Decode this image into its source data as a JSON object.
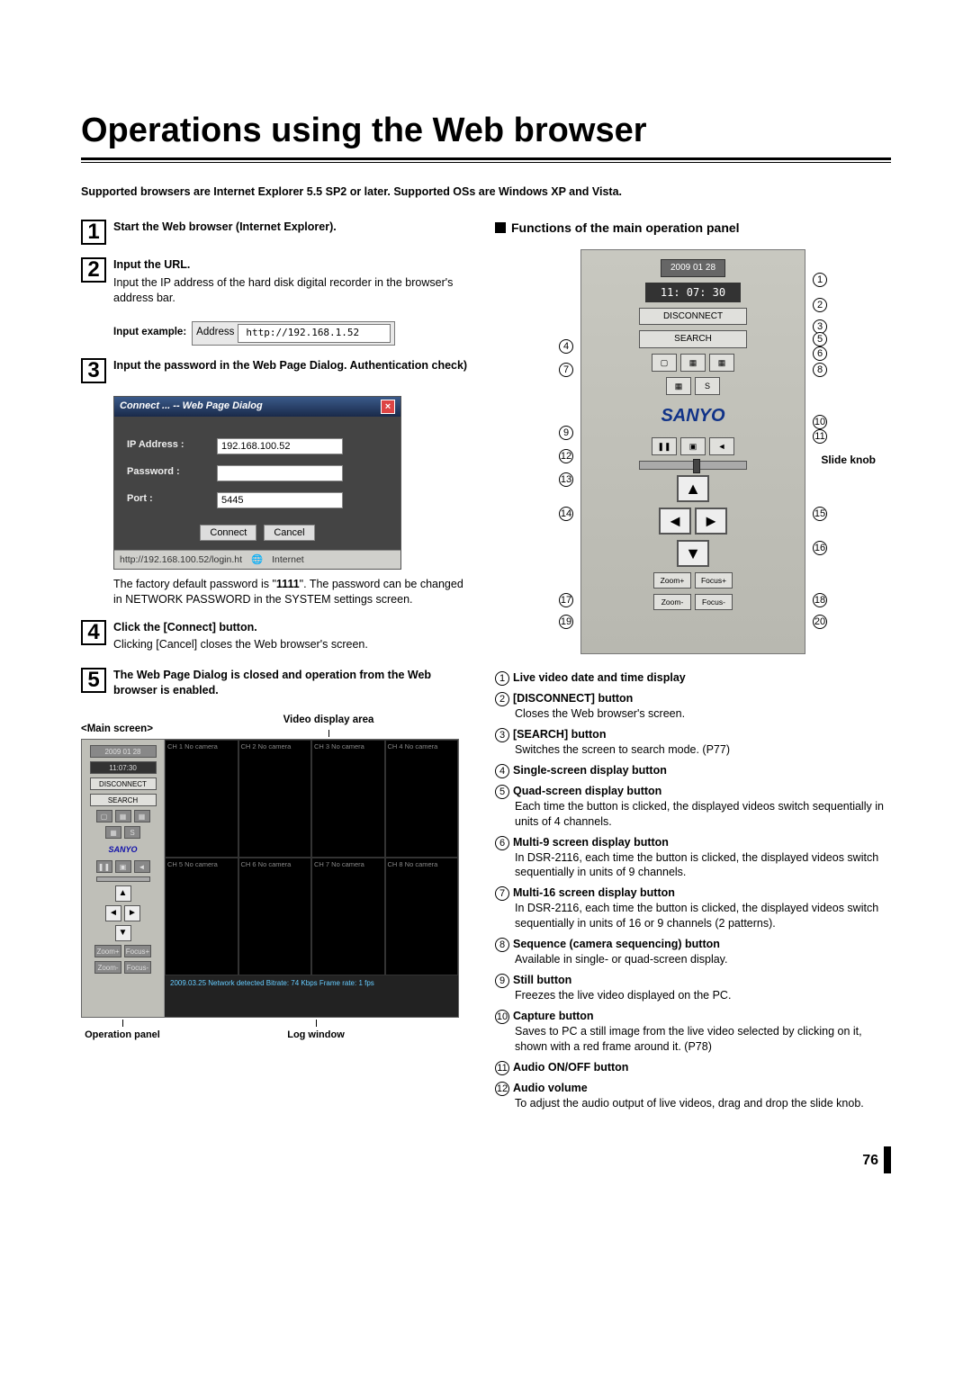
{
  "title": "Operations using the Web browser",
  "intro": "Supported browsers are Internet Explorer 5.5 SP2 or later. Supported OSs are Windows XP and Vista.",
  "steps": {
    "s1": {
      "num": "1",
      "title": "Start the Web browser (Internet Explorer)."
    },
    "s2": {
      "num": "2",
      "title": "Input the URL.",
      "body": "Input the IP address of the hard disk digital recorder in the browser's address bar."
    },
    "input_example": {
      "label": "Input example:",
      "addr_label": "Address",
      "url": "http://192.168.1.52"
    },
    "s3": {
      "num": "3",
      "title": "Input the password in the Web Page Dialog. Authentication check)"
    },
    "dialog": {
      "title": "Connect ... -- Web Page Dialog",
      "ip_label": "IP Address :",
      "ip_value": "192.168.100.52",
      "pw_label": "Password :",
      "pw_value": "",
      "port_label": "Port :",
      "port_value": "5445",
      "connect": "Connect",
      "cancel": "Cancel",
      "status_url": "http://192.168.100.52/login.ht",
      "status_zone": "Internet"
    },
    "s3_note_a": "The factory default password is \"",
    "s3_note_pw": "1111",
    "s3_note_b": "\". The password can be changed in NETWORK PASSWORD in the SYSTEM settings screen.",
    "s4": {
      "num": "4",
      "title": "Click the [Connect] button.",
      "body": "Clicking [Cancel] closes the Web browser's screen."
    },
    "s5": {
      "num": "5",
      "title": "The Web Page Dialog is closed and operation from the Web browser is enabled."
    },
    "mainscreen_label": "<Main screen>",
    "video_area_label": "Video display area",
    "op_panel_label": "Operation panel",
    "log_label": "Log window",
    "ms_panel": {
      "date": "2009 01 28",
      "time": "11:07:30",
      "disconnect": "DISCONNECT",
      "search": "SEARCH",
      "brand": "SANYO",
      "zoom_p": "Zoom+",
      "focus_p": "Focus+",
      "zoom_m": "Zoom-",
      "focus_m": "Focus-"
    },
    "video_cells": {
      "c1": "CH 1\nNo camera",
      "c2": "CH 2\nNo camera",
      "c3": "CH 3\nNo camera",
      "c4": "CH 4\nNo camera",
      "c5": "CH 5\nNo camera",
      "c6": "CH 6\nNo camera",
      "c7": "CH 7\nNo camera",
      "c8": "CH 8\nNo camera"
    },
    "video_log": "2009.03.25 Network detected\nBitrate: 74 Kbps  Frame rate: 1 fps"
  },
  "right": {
    "section_title": "Functions of the main operation panel",
    "panel": {
      "date": "2009  01  28",
      "time": "11: 07: 30",
      "disconnect": "DISCONNECT",
      "search": "SEARCH",
      "s_btn": "S",
      "brand": "SANYO",
      "zoom_p": "Zoom+",
      "focus_p": "Focus+",
      "zoom_m": "Zoom-",
      "focus_m": "Focus-"
    },
    "slide_knob": "Slide knob",
    "functions": [
      {
        "n": "1",
        "t": "Live video date and time display",
        "b": ""
      },
      {
        "n": "2",
        "t": "[DISCONNECT] button",
        "b": "Closes the Web browser's screen."
      },
      {
        "n": "3",
        "t": "[SEARCH] button",
        "b": "Switches the screen to search mode. (P77)"
      },
      {
        "n": "4",
        "t": "Single-screen display button",
        "b": ""
      },
      {
        "n": "5",
        "t": "Quad-screen display button",
        "b": "Each time the button is clicked, the displayed videos switch sequentially in units of 4 channels."
      },
      {
        "n": "6",
        "t": "Multi-9 screen display button",
        "b": "In DSR-2116, each time the button is clicked, the displayed videos switch sequentially in units of 9 channels."
      },
      {
        "n": "7",
        "t": "Multi-16 screen display button",
        "b": "In DSR-2116, each time the button is clicked, the displayed videos switch sequentially in units of 16 or 9 channels (2 patterns)."
      },
      {
        "n": "8",
        "t": "Sequence (camera sequencing) button",
        "b": "Available in single- or quad-screen display."
      },
      {
        "n": "9",
        "t": "Still button",
        "b": "Freezes the live video displayed on the PC."
      },
      {
        "n": "10",
        "t": "Capture button",
        "b": "Saves to PC a still image from the live video selected by clicking on it, shown with a red frame around it. (P78)"
      },
      {
        "n": "11",
        "t": "Audio ON/OFF button",
        "b": ""
      },
      {
        "n": "12",
        "t": "Audio volume",
        "b": "To adjust the audio output of live videos, drag and drop the slide knob."
      }
    ]
  },
  "page_number": "76"
}
